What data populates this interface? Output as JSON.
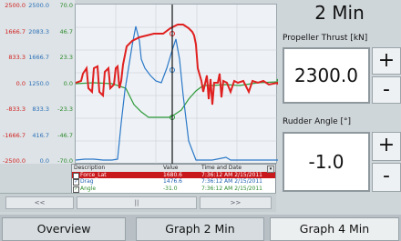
{
  "axes": {
    "red": [
      "2500.0",
      "1666.7",
      "833.3",
      "0.0",
      "-833.3",
      "-1666.7",
      "-2500.0"
    ],
    "blue": [
      "2500.0",
      "2083.3",
      "1666.7",
      "1250.0",
      "833.3",
      "416.7",
      "0.0"
    ],
    "green": [
      "70.0",
      "46.7",
      "23.3",
      "0.0",
      "-23.3",
      "-46.7",
      "-70.0"
    ]
  },
  "legend": {
    "headers": {
      "description": "Description",
      "value": "Value",
      "time": "Time and Date"
    },
    "rows": [
      {
        "description": "Force_Lat",
        "value": "1680.6",
        "time": "7:36:12 AM 2/15/2011"
      },
      {
        "description": "Drag",
        "value": "1476.6",
        "time": "7:36:12 AM 2/15/2011"
      },
      {
        "description": "Angle",
        "value": "-31.0",
        "time": "7:36:12 AM 2/15/2011"
      }
    ]
  },
  "scrollbar": {
    "left": "<<",
    "mid": "||",
    "right": ">>"
  },
  "panel": {
    "window_label": "2 Min",
    "thrust_label": "Propeller Thrust [kN]",
    "thrust_value": "2300.0",
    "rudder_label": "Rudder Angle [°]",
    "rudder_value": "-1.0",
    "plus": "+",
    "minus": "-"
  },
  "tabs": [
    {
      "label": "Overview"
    },
    {
      "label": "Graph 2 Min"
    },
    {
      "label": "Graph 4 Min"
    }
  ],
  "colors": {
    "red": "#e02020",
    "blue": "#2b78c8",
    "green": "#2e9a3a"
  }
}
